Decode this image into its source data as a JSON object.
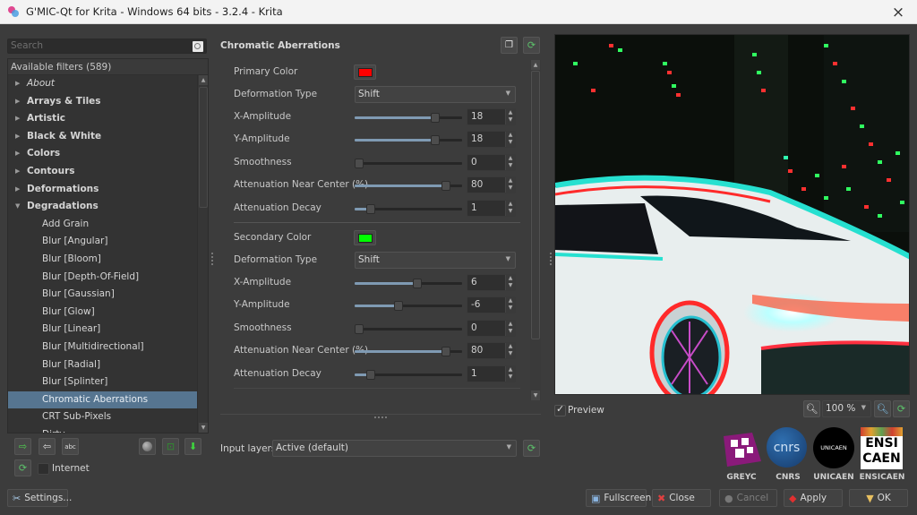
{
  "window": {
    "title": "G'MIC-Qt for Krita - Windows 64 bits - 3.2.4 - Krita",
    "close_label": "×"
  },
  "filters_panel": {
    "search_placeholder": "Search",
    "header": "Available filters (589)",
    "categories": [
      {
        "label": "About",
        "expanded": false,
        "italic": true
      },
      {
        "label": "Arrays & Tiles",
        "expanded": false
      },
      {
        "label": "Artistic",
        "expanded": false
      },
      {
        "label": "Black & White",
        "expanded": false
      },
      {
        "label": "Colors",
        "expanded": false
      },
      {
        "label": "Contours",
        "expanded": false
      },
      {
        "label": "Deformations",
        "expanded": false
      },
      {
        "label": "Degradations",
        "expanded": true
      }
    ],
    "degradations_items": [
      "Add Grain",
      "Blur [Angular]",
      "Blur [Bloom]",
      "Blur [Depth-Of-Field]",
      "Blur [Gaussian]",
      "Blur [Glow]",
      "Blur [Linear]",
      "Blur [Multidirectional]",
      "Blur [Radial]",
      "Blur [Splinter]",
      "Chromatic Aberrations",
      "CRT Sub-Pixels",
      "Dirty"
    ],
    "selected_item": "Chromatic Aberrations",
    "internet_label": "Internet",
    "internet_checked": false,
    "settings_label": "Settings..."
  },
  "filter": {
    "title": "Chromatic Aberrations",
    "primary": {
      "color_label": "Primary Color",
      "color": "#ff0000",
      "deformation_label": "Deformation Type",
      "deformation_value": "Shift",
      "x_amp_label": "X-Amplitude",
      "x_amp": "18",
      "x_amp_frac": 0.75,
      "y_amp_label": "Y-Amplitude",
      "y_amp": "18",
      "y_amp_frac": 0.75,
      "smooth_label": "Smoothness",
      "smooth": "0",
      "smooth_frac": 0.0,
      "atten_center_label": "Attenuation Near Center (%)",
      "atten_center": "80",
      "atten_center_frac": 0.85,
      "atten_decay_label": "Attenuation Decay",
      "atten_decay": "1",
      "atten_decay_frac": 0.15
    },
    "secondary": {
      "color_label": "Secondary Color",
      "color": "#00ff00",
      "deformation_label": "Deformation Type",
      "deformation_value": "Shift",
      "x_amp_label": "X-Amplitude",
      "x_amp": "6",
      "x_amp_frac": 0.58,
      "y_amp_label": "Y-Amplitude",
      "y_amp": "-6",
      "y_amp_frac": 0.41,
      "smooth_label": "Smoothness",
      "smooth": "0",
      "smooth_frac": 0.0,
      "atten_center_label": "Attenuation Near Center (%)",
      "atten_center": "80",
      "atten_center_frac": 0.85,
      "atten_decay_label": "Attenuation Decay",
      "atten_decay": "1",
      "atten_decay_frac": 0.15
    },
    "input_layers_label": "Input layers",
    "input_layers_value": "Active (default)"
  },
  "preview": {
    "checkbox_label": "Preview",
    "checked": true,
    "zoom_value": "100 %"
  },
  "logos": [
    {
      "name": "GREYC"
    },
    {
      "name": "CNRS",
      "text": "cnrs"
    },
    {
      "name": "UNICAEN",
      "text": "UNICAEN"
    },
    {
      "name": "ENSICAEN",
      "text1": "ENSI",
      "text2": "CAEN"
    }
  ],
  "buttons": {
    "fullscreen": "Fullscreen",
    "close": "Close",
    "cancel": "Cancel",
    "apply": "Apply",
    "ok": "OK"
  },
  "colors": {
    "selection": "#567590",
    "slider_fill": "#7f9ab3",
    "refresh_green": "#55c060"
  }
}
